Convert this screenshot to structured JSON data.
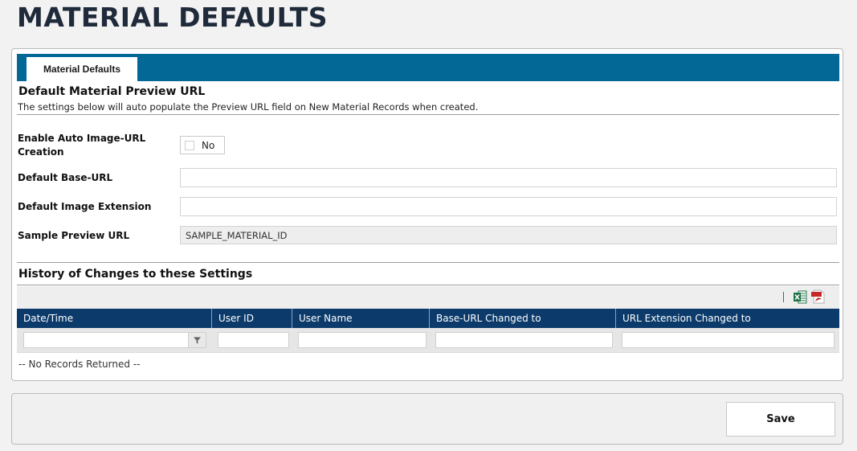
{
  "page": {
    "title": "MATERIAL DEFAULTS"
  },
  "tabs": [
    {
      "label": "Material Defaults",
      "active": true
    }
  ],
  "preview_section": {
    "title": "Default Material Preview URL",
    "description": "The settings below will auto populate the Preview URL field on New Material Records when created."
  },
  "form": {
    "enable_auto_label": "Enable Auto Image-URL Creation",
    "enable_auto_value": "No",
    "base_url_label": "Default Base-URL",
    "base_url_value": "",
    "image_ext_label": "Default Image Extension",
    "image_ext_value": "",
    "sample_preview_label": "Sample Preview URL",
    "sample_preview_value": "SAMPLE_MATERIAL_ID"
  },
  "history": {
    "title": "History of Changes to these Settings",
    "toolbar": {
      "excel_icon": "excel-export-icon",
      "pdf_icon": "pdf-export-icon"
    },
    "columns": [
      "Date/Time",
      "User ID",
      "User Name",
      "Base-URL Changed to",
      "URL Extension Changed to"
    ],
    "empty_text": "-- No Records Returned --"
  },
  "footer": {
    "save_label": "Save"
  },
  "colors": {
    "tab_strip": "#046896",
    "grid_header": "#0c3b6b",
    "title_text": "#1f2a3a",
    "excel_green": "#1e7145",
    "pdf_red": "#c62828"
  }
}
